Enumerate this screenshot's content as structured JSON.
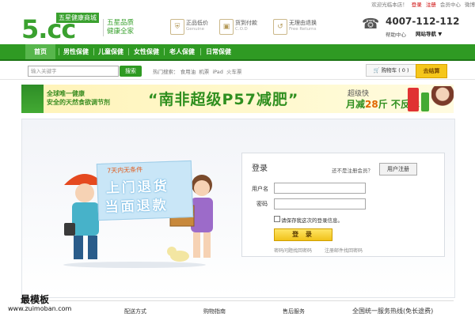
{
  "topbar": {
    "welcome": "欢迎光临本店！",
    "login": "登录",
    "register": "注册",
    "member": "会员中心",
    "weibo": "微博"
  },
  "header": {
    "logo_name": "五星健康商城",
    "logo_big": "5.cc",
    "slogan_line1": "五星品质",
    "slogan_line2": "健康全家",
    "promises": [
      {
        "icon": "shield-icon",
        "title": "正品低价",
        "sub": "Genuine"
      },
      {
        "icon": "card-icon",
        "title": "货到付款",
        "sub": "C.O.D"
      },
      {
        "icon": "return-icon",
        "title": "无理由退换",
        "sub": "Free Returns"
      }
    ],
    "phone": "4007-112-112",
    "help": "帮助中心",
    "site_nav": "网站导航"
  },
  "nav": {
    "items": [
      "首页",
      "男性保健",
      "儿童保健",
      "女性保健",
      "老人保健",
      "日常保健"
    ],
    "active": "首页"
  },
  "search": {
    "placeholder": "输入关键字",
    "button": "搜索",
    "hot_label": "热门搜索：",
    "hot_items": [
      "食用油",
      "机票",
      "iPad",
      "火车票"
    ],
    "cart": "购物车 ( 0 )",
    "checkout": "去结算"
  },
  "banner": {
    "left1": "全球唯一健康",
    "left2": "安全的天然食欲调节剂",
    "mid": "“南非超级P57减肥”",
    "right1": "超级快",
    "right2_prefix": "月减",
    "right2_num": "28",
    "right2_suffix": "斤 不反弹"
  },
  "illustration": {
    "sign_top": "7天内无条件",
    "sign_line1": "上门退货",
    "sign_line2": "当面退款"
  },
  "login": {
    "title": "登录",
    "no_account": "还不是注册会员？",
    "register_button": "用户注册",
    "username_label": "用户名",
    "password_label": "密码",
    "remember": "请保存我这次的登录信息。",
    "submit": "登 录",
    "forgot_question": "密码问题找回密码",
    "forgot_email": "注册邮件找回密码"
  },
  "footer": {
    "col1": "配送方式",
    "col2": "购物指南",
    "col3": "售后服务",
    "hotline": "全国统一服务热线(免长途费)"
  },
  "watermark": {
    "title": "最模板",
    "url": "www.zuimoban.com"
  }
}
